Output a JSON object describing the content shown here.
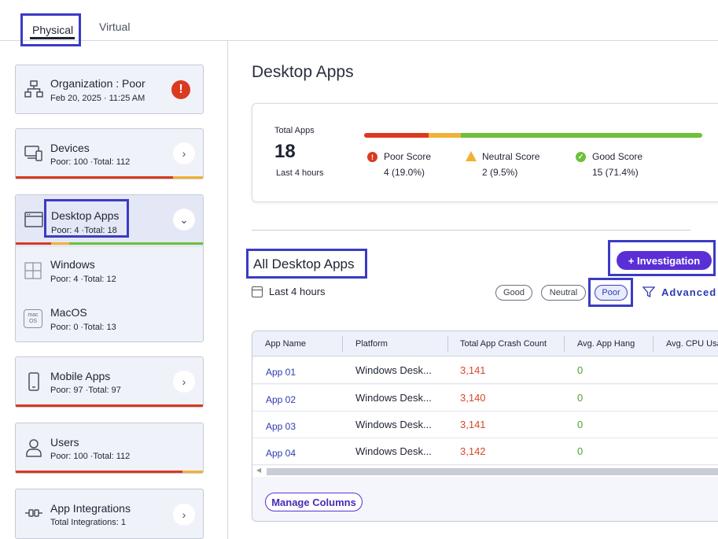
{
  "tabs": {
    "physical": "Physical",
    "virtual": "Virtual"
  },
  "sidebar": {
    "organization": {
      "title": "Organization : Poor",
      "date": "Feb 20, 2025 · 11:25 AM"
    },
    "devices": {
      "title": "Devices",
      "stats": "Poor: 100 ·Total: 112",
      "poor_fraction": 0.89
    },
    "desktop_apps": {
      "title": "Desktop Apps",
      "stats": "Poor: 4 ·Total: 18",
      "children": [
        {
          "title": "Windows",
          "stats": "Poor: 4 ·Total: 12"
        },
        {
          "title": "MacOS",
          "stats": "Poor: 0 ·Total: 13",
          "icon_text": "mac OS"
        }
      ]
    },
    "mobile_apps": {
      "title": "Mobile Apps",
      "stats": "Poor: 97 ·Total: 97"
    },
    "users": {
      "title": "Users",
      "stats": "Poor: 100 ·Total: 112",
      "poor_fraction": 0.89
    },
    "app_integrations": {
      "title": "App Integrations",
      "stats": "Total Integrations: 1"
    }
  },
  "main": {
    "title": "Desktop Apps",
    "summary": {
      "total_label": "Total Apps",
      "total_value": "18",
      "period": "Last 4 hours",
      "poor": {
        "label": "Poor Score",
        "value": "4 (19.0%)",
        "fraction": 0.19
      },
      "neutral": {
        "label": "Neutral Score",
        "value": "2 (9.5%)",
        "fraction": 0.095
      },
      "good": {
        "label": "Good Score",
        "value": "15 (71.4%)",
        "fraction": 0.714
      }
    },
    "section_title": "All Desktop Apps",
    "investigation_button": "+ Investigation",
    "date_filter": "Last 4 hours",
    "filters": {
      "good": "Good",
      "neutral": "Neutral",
      "poor": "Poor"
    },
    "advanced": "Advanced",
    "table": {
      "columns": [
        "App Name",
        "Platform",
        "Total App Crash Count",
        "Avg. App Hang",
        "Avg. CPU Usa"
      ],
      "rows": [
        [
          "App 01",
          "Windows Desk...",
          "3,141",
          "0"
        ],
        [
          "App 02",
          "Windows Desk...",
          "3,140",
          "0"
        ],
        [
          "App 03",
          "Windows Desk...",
          "3,141",
          "0"
        ],
        [
          "App 04",
          "Windows Desk...",
          "3,142",
          "0"
        ]
      ]
    },
    "manage_columns": "Manage Columns"
  },
  "colors": {
    "poor": "#d93a20",
    "neutral": "#f2b134",
    "good": "#6cc138",
    "accent": "#5b2fd6",
    "highlight": "#3b3bc4"
  }
}
